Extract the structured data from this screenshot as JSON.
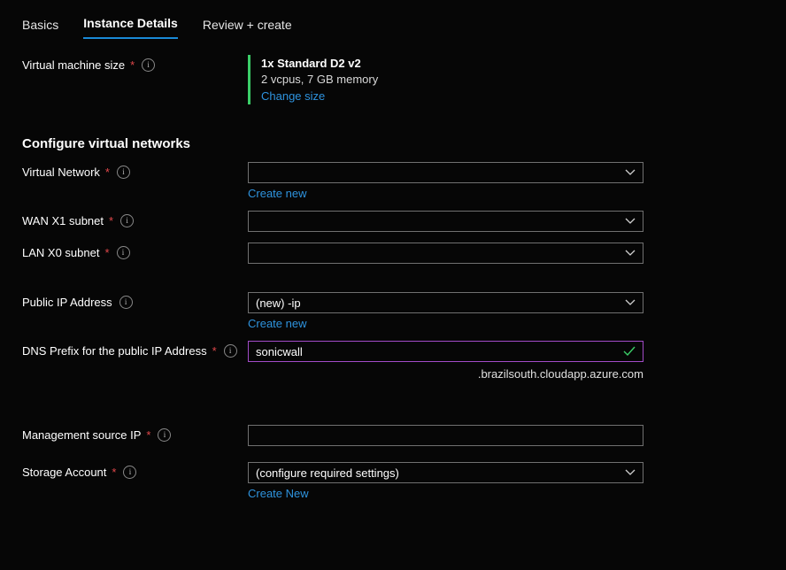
{
  "tabs": {
    "basics": "Basics",
    "instance_details": "Instance Details",
    "review_create": "Review + create"
  },
  "vm_size": {
    "label": "Virtual machine size",
    "title": "1x Standard D2 v2",
    "subtitle": "2 vcpus, 7 GB memory",
    "change": "Change size"
  },
  "section_network_title": "Configure virtual networks",
  "vnet": {
    "label": "Virtual Network",
    "value": "",
    "create": "Create new"
  },
  "wan": {
    "label": "WAN X1 subnet",
    "value": ""
  },
  "lan": {
    "label": "LAN X0 subnet",
    "value": ""
  },
  "public_ip": {
    "label": "Public IP Address",
    "value": "(new) -ip",
    "create": "Create new"
  },
  "dns": {
    "label": "DNS Prefix for the public IP Address",
    "value": "sonicwall",
    "suffix": ".brazilsouth.cloudapp.azure.com"
  },
  "mgmt_ip": {
    "label": "Management source IP",
    "value": ""
  },
  "storage": {
    "label": "Storage Account",
    "value": "(configure required settings)",
    "create": "Create New"
  }
}
